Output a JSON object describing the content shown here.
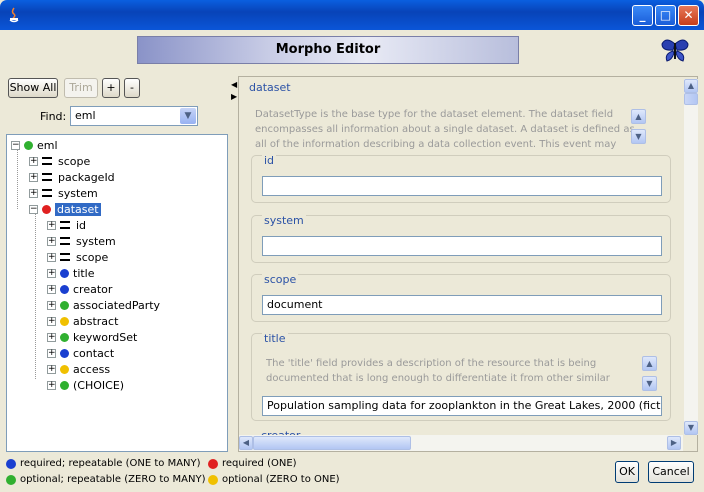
{
  "window": {
    "title": ""
  },
  "banner": {
    "title": "Morpho Editor"
  },
  "toolbar": {
    "show_all": "Show All",
    "trim": "Trim",
    "plus": "+",
    "minus": "-"
  },
  "find": {
    "label": "Find:",
    "value": "eml"
  },
  "tree": {
    "root": "eml",
    "items": [
      {
        "label": "scope"
      },
      {
        "label": "packageId"
      },
      {
        "label": "system"
      },
      {
        "label": "dataset"
      },
      {
        "label": "id"
      },
      {
        "label": "system"
      },
      {
        "label": "scope"
      },
      {
        "label": "title"
      },
      {
        "label": "creator"
      },
      {
        "label": "associatedParty"
      },
      {
        "label": "abstract"
      },
      {
        "label": "keywordSet"
      },
      {
        "label": "contact"
      },
      {
        "label": "access"
      },
      {
        "label": "(CHOICE)"
      }
    ]
  },
  "editor": {
    "section_label": "dataset",
    "description": "DatasetType is the base type for the dataset element. The dataset field encompasses all information about a single dataset. A dataset is defined as all of the information describing a data collection event. This event may take",
    "fields": [
      {
        "label": "id",
        "value": ""
      },
      {
        "label": "system",
        "value": ""
      },
      {
        "label": "scope",
        "value": "document"
      },
      {
        "label": "title",
        "description": "The 'title' field provides a description of the resource that is being documented that is long enough to differentiate it from other similar resources. Multiple titles may be provided, particularly when trying to express the title in more than one",
        "value": "Population sampling data for zooplankton in the Great Lakes,        2000 (fictitious s"
      }
    ],
    "next_label": "creator"
  },
  "legend": {
    "items": [
      {
        "text": "required; repeatable (ONE to MANY)",
        "color": "#1a3fd0"
      },
      {
        "text": "required (ONE)",
        "color": "#e02020"
      },
      {
        "text": "optional; repeatable (ZERO to MANY)",
        "color": "#30b030"
      },
      {
        "text": "optional (ZERO to ONE)",
        "color": "#f0c000"
      }
    ]
  },
  "buttons": {
    "ok": "OK",
    "cancel": "Cancel"
  },
  "colors": {
    "blue": "#1a3fd0",
    "red": "#e02020",
    "green": "#30b030",
    "yellow": "#f0c000",
    "accent": "#2b52a6"
  }
}
